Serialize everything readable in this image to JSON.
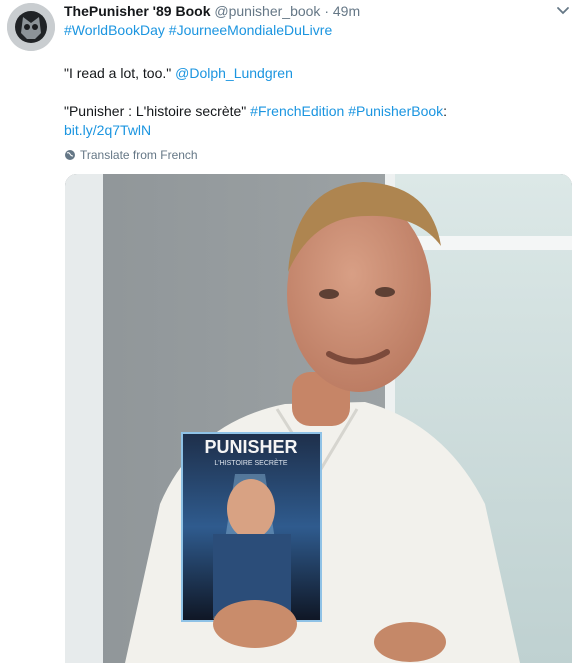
{
  "tweet": {
    "display_name": "ThePunisher '89 Book",
    "handle": "@punisher_book",
    "separator": "·",
    "time": "49m",
    "hashtags": [
      "#WorldBookDay",
      "#JourneeMondialeDuLivre"
    ],
    "quote_text": "\"I read a lot, too.\"",
    "mention": "@Dolph_Lundgren",
    "line2_text": "\"Punisher : L'histoire secrète\"",
    "line2_tags": [
      "#FrenchEdition",
      "#PunisherBook"
    ],
    "line2_colon": ":",
    "short_link": "bit.ly/2q7TwlN",
    "translate_label": "Translate from French"
  },
  "media": {
    "book_title": "PUNISHER",
    "book_subtitle": "L'HISTOIRE SECRÈTE"
  },
  "colors": {
    "link": "#1b95e0",
    "secondary_text": "#657786",
    "primary_text": "#14171a"
  },
  "icons": {
    "avatar": "avatar-skull",
    "menu": "chevron-down-icon",
    "translate": "globe-icon"
  }
}
